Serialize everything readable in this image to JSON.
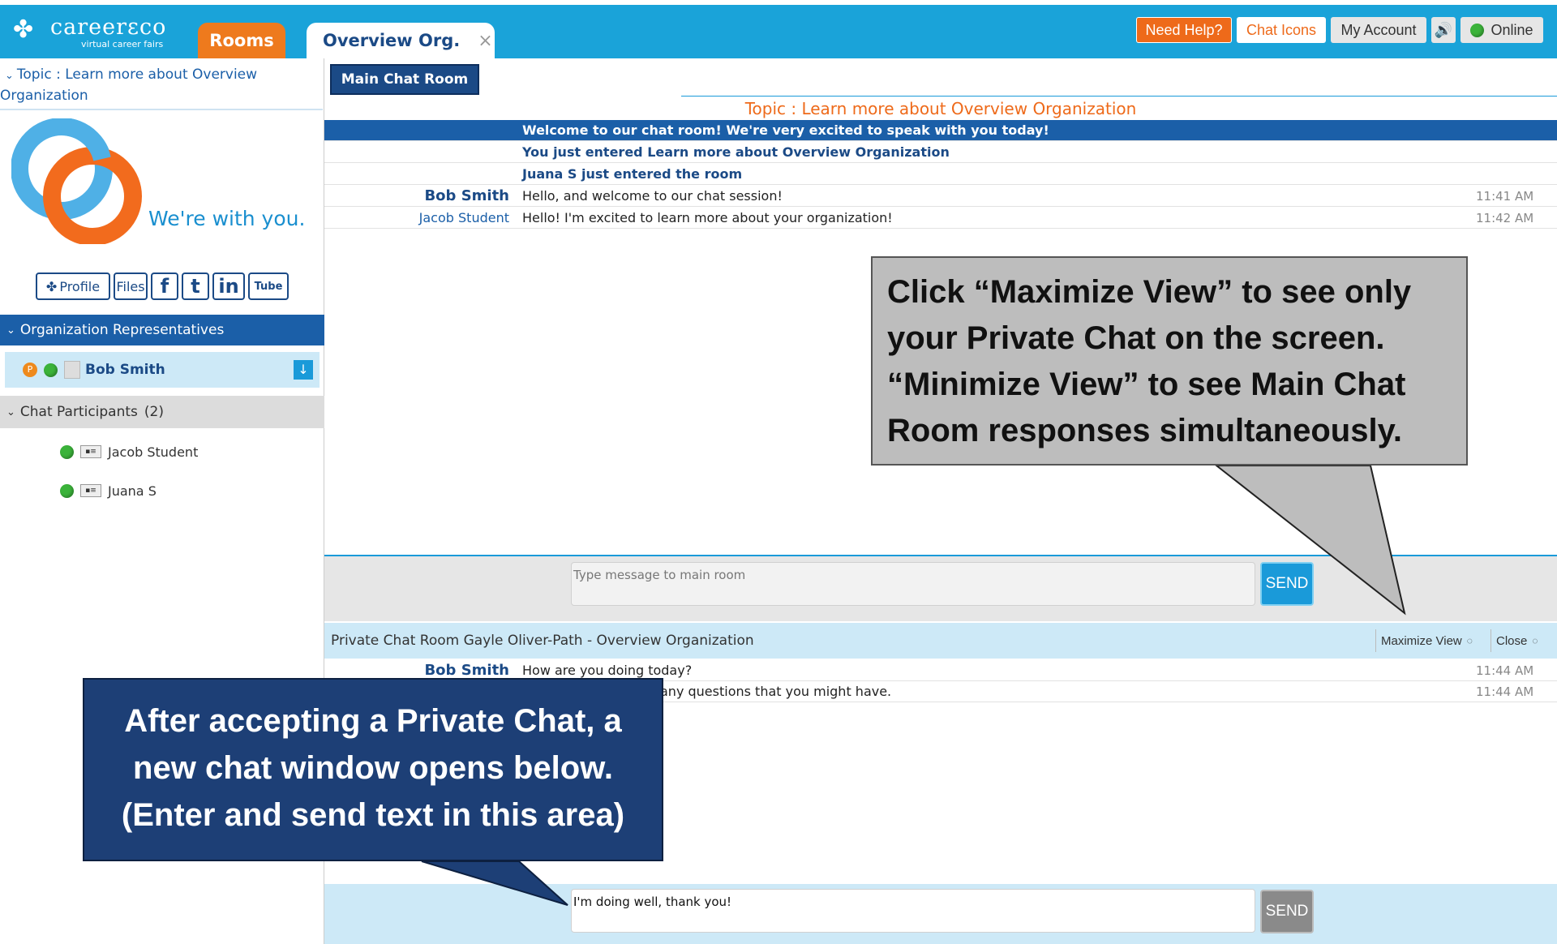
{
  "header": {
    "logo_name": "careerεco",
    "logo_tagline": "virtual career fairs",
    "tabs": [
      {
        "label": "Rooms"
      },
      {
        "label": "Overview Org.",
        "close": "×"
      }
    ],
    "buttons": {
      "need_help": "Need Help?",
      "chat_icons": "Chat Icons",
      "my_account": "My Account",
      "sound": "🔊",
      "online": "Online"
    }
  },
  "sidebar": {
    "topic": "Topic : Learn more about Overview Organization",
    "brand_tagline": "We're with you.",
    "social": {
      "profile": "Profile",
      "files": "Files",
      "facebook": "f",
      "twitter": "t",
      "linkedin": "in",
      "youtube": "Tube"
    },
    "org_reps_header": "Organization Representatives",
    "rep": {
      "badge": "P",
      "name": "Bob Smith"
    },
    "participants_header": "Chat Participants",
    "participants_count": "(2)",
    "participants": [
      "Jacob Student",
      "Juana S"
    ]
  },
  "main": {
    "room_tab": "Main Chat Room",
    "topic": "Topic : Learn more about Overview Organization",
    "system_messages": [
      "Welcome to our chat room! We're very excited to speak with you today!",
      "You just entered Learn more about Overview Organization",
      "Juana S just entered the room"
    ],
    "messages": [
      {
        "sender": "Bob Smith",
        "text": "Hello, and welcome to our chat session!",
        "time": "11:41 AM"
      },
      {
        "sender": "Jacob Student",
        "text": "Hello! I'm excited to learn more about your organization!",
        "time": "11:42 AM"
      }
    ],
    "input_placeholder": "Type message to main room",
    "send": "SEND"
  },
  "private": {
    "header": "Private Chat Room Gayle Oliver-Path - Overview Organization",
    "maximize": "Maximize View",
    "close": "Close",
    "messages": [
      {
        "sender": "Bob Smith",
        "text": "How are you doing today?",
        "time": "11:44 AM"
      },
      {
        "sender": "",
        "text": "any questions that you might have.",
        "time": "11:44 AM"
      }
    ],
    "input_value": "I'm doing well, thank you!",
    "send": "SEND"
  },
  "callouts": {
    "right": [
      "Click “Maximize View” to see only",
      "your Private Chat on the screen.",
      "“Minimize View”  to see Main Chat",
      "Room responses simultaneously."
    ],
    "left": [
      "After accepting a Private Chat, a",
      "new chat window opens below.",
      "(Enter and send text in this area)"
    ]
  },
  "colors": {
    "topbar": "#1aa3d9",
    "rooms_tab": "#ee7a1d",
    "navy": "#1b4a86",
    "private_bg": "#cde9f7",
    "send_active": "#1a9ad9",
    "send_inactive": "#8a8a8a"
  }
}
